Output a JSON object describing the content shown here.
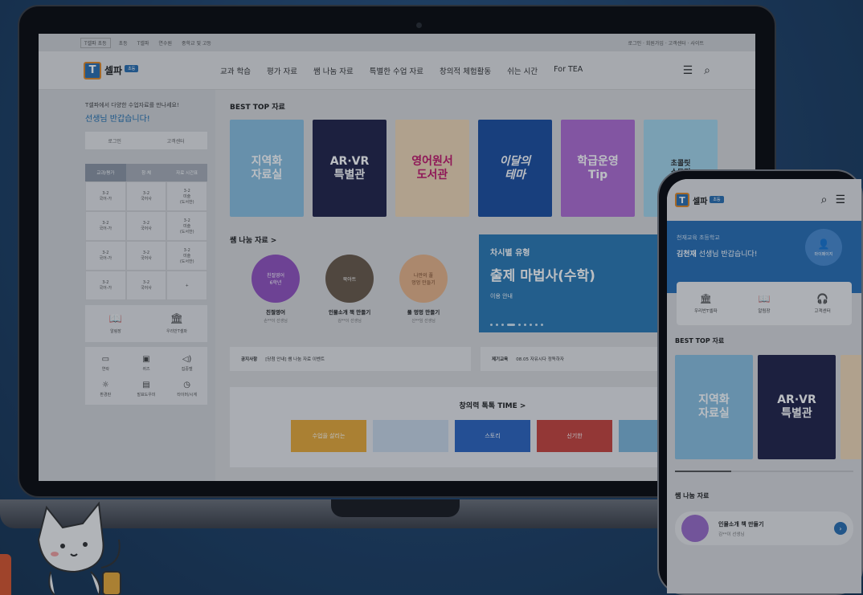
{
  "topbar": {
    "site": "T셀파 초등",
    "items": [
      "초등",
      "T셀파",
      "연수원",
      "중학교 및 고등",
      "기"
    ],
    "right": "로그인 · 회원가입 · 고객센터 · 사이트"
  },
  "header": {
    "logo_text": "셀파",
    "logo_badge": "초등",
    "nav": [
      "교과 학습",
      "평가 자료",
      "쌤 나눔 자료",
      "특별한 수업 자료",
      "창의적 체험활동",
      "쉬는 시간",
      "For TEA"
    ]
  },
  "sidebar": {
    "greeting": "T셀파에서 다양한 수업자료를 만나세요!",
    "hello": "선생님 반갑습니다!",
    "login": "로그인",
    "support": "고객센터",
    "tabs": [
      "교과/평가",
      "창·체",
      "자료 시간표"
    ],
    "grid": [
      "3-2\n국어-가",
      "3-2\n국어사",
      "3-2\n미술\n(도서한)",
      "3-2\n국어-가",
      "3-2\n국어사",
      "3-2\n미술\n(도서한)",
      "3-2\n국어-가",
      "3-2\n국어사",
      "3-2\n미술\n(도서한)",
      "3-2\n국어-가",
      "3-2\n국어사",
      "+"
    ],
    "quick2": [
      "알림장",
      "우리반T셀파"
    ],
    "quick6": [
      "연락",
      "퀴즈",
      "집중벨",
      "환경판",
      "발표도우미",
      "타이머/시계"
    ]
  },
  "main": {
    "best_title": "BEST TOP 자료",
    "cards": [
      "지역화\n자료실",
      "AR·VR\n특별관",
      "영어원서\n도서관",
      "이달의\n테마",
      "학급운영\nTip",
      "초콜릿\n스토리"
    ],
    "share_title": "쌤 나눔 자료 >",
    "bubbles": [
      {
        "img": "친절영어\n6학년",
        "title": "친절영어",
        "sub": "손**이 선생님"
      },
      {
        "img": "북아트",
        "title": "인물소개 책 만들기",
        "sub": "김**이 선생님"
      },
      {
        "img": "나만의 풀\n멍멍 만들기",
        "title": "풀 멍멍 만들기",
        "sub": "신**임 선생님"
      }
    ],
    "banner": {
      "tag": "차시별 유형",
      "title": "출제 마법사(수학)",
      "sub": "이용 안내"
    },
    "notice1": {
      "label": "공지사항",
      "text": "[당첨 안내] 쌤 나눔 자료 이벤트"
    },
    "notice2": {
      "label": "제기교육",
      "text": "08.05 자유시다 정독하자"
    },
    "creative_title": "창의력 톡톡 TIME >",
    "creative_cards": [
      "수업을 살리는",
      "",
      "스토리",
      "신기한",
      ""
    ]
  },
  "phone": {
    "logo_text": "셀파",
    "logo_badge": "초등",
    "school": "천재교육 초등학교",
    "name": "김천재",
    "greet": "선생님 반갑습니다!",
    "mypage": "마이페이지",
    "quick": [
      "우리반T셀파",
      "알림장",
      "고객센터"
    ],
    "best_title": "BEST TOP 자료",
    "cards": [
      "지역화\n자료실",
      "AR·VR\n특별관"
    ],
    "share_title": "쌤 나눔 자료",
    "item_title": "인물소개 책 만들기",
    "item_sub": "김**이 선생님"
  }
}
